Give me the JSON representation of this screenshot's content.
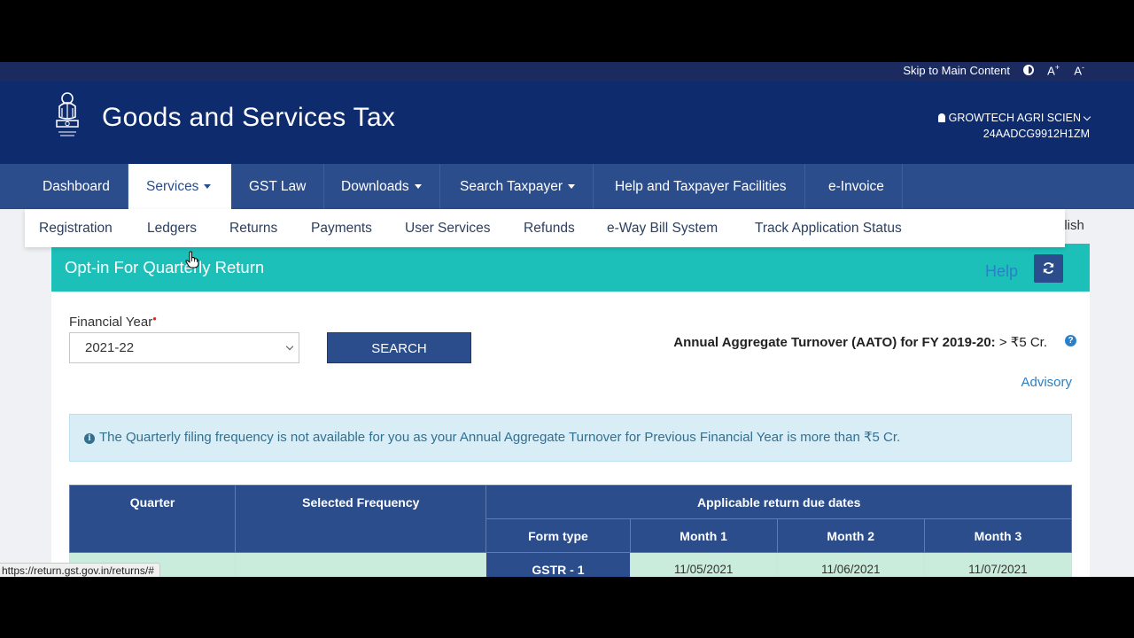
{
  "topbar": {
    "skip_label": "Skip to Main Content",
    "font_increase": "A",
    "font_increase_sup": "+",
    "font_decrease": "A",
    "font_decrease_sup": "-"
  },
  "header": {
    "title": "Goods and Services Tax",
    "user_name": "GROWTECH AGRI SCIEN",
    "gstin": "24AADCG9912H1ZM"
  },
  "nav": {
    "items": [
      {
        "label": "Dashboard"
      },
      {
        "label": "Services"
      },
      {
        "label": "GST Law"
      },
      {
        "label": "Downloads"
      },
      {
        "label": "Search Taxpayer"
      },
      {
        "label": "Help and Taxpayer Facilities"
      },
      {
        "label": "e-Invoice"
      }
    ]
  },
  "submenu": {
    "items": [
      {
        "label": "Registration"
      },
      {
        "label": "Ledgers"
      },
      {
        "label": "Returns"
      },
      {
        "label": "Payments"
      },
      {
        "label": "User Services"
      },
      {
        "label": "Refunds"
      },
      {
        "label": "e-Way Bill System"
      },
      {
        "label": "Track Application Status"
      }
    ],
    "peek_text": "glish"
  },
  "panel": {
    "title": "Opt-in For Quarterly Return",
    "help_label": "Help",
    "fy_label": "Financial Year",
    "fy_required": "•",
    "fy_value": "2021-22",
    "search_label": "SEARCH",
    "aato_label": "Annual Aggregate Turnover (AATO) for FY 2019-20:",
    "aato_value": "> ₹5 Cr.",
    "help_icon": "?",
    "advisory_label": "Advisory",
    "info_icon": "i",
    "info_text": "The Quarterly filing frequency is not available for you as your Annual Aggregate Turnover for Previous Financial Year is more than ₹5 Cr."
  },
  "table": {
    "headers": {
      "quarter": "Quarter",
      "selected_frequency": "Selected Frequency",
      "due_dates": "Applicable return due dates",
      "form_type": "Form type",
      "month1": "Month 1",
      "month2": "Month 2",
      "month3": "Month 3"
    },
    "rows": [
      {
        "quarter": "",
        "frequency": "",
        "form_type": "GSTR - 1",
        "month1": "11/05/2021",
        "month2": "11/06/2021",
        "month3": "11/07/2021"
      }
    ]
  },
  "statusbar": {
    "url": "https://return.gst.gov.in/returns/#"
  },
  "colors": {
    "header_bg": "#0e2b6e",
    "nav_bg": "#2b4d8c",
    "panel_head": "#1cc0b9",
    "info_bg": "#d9edf7",
    "row_green": "#c9ecdc"
  }
}
